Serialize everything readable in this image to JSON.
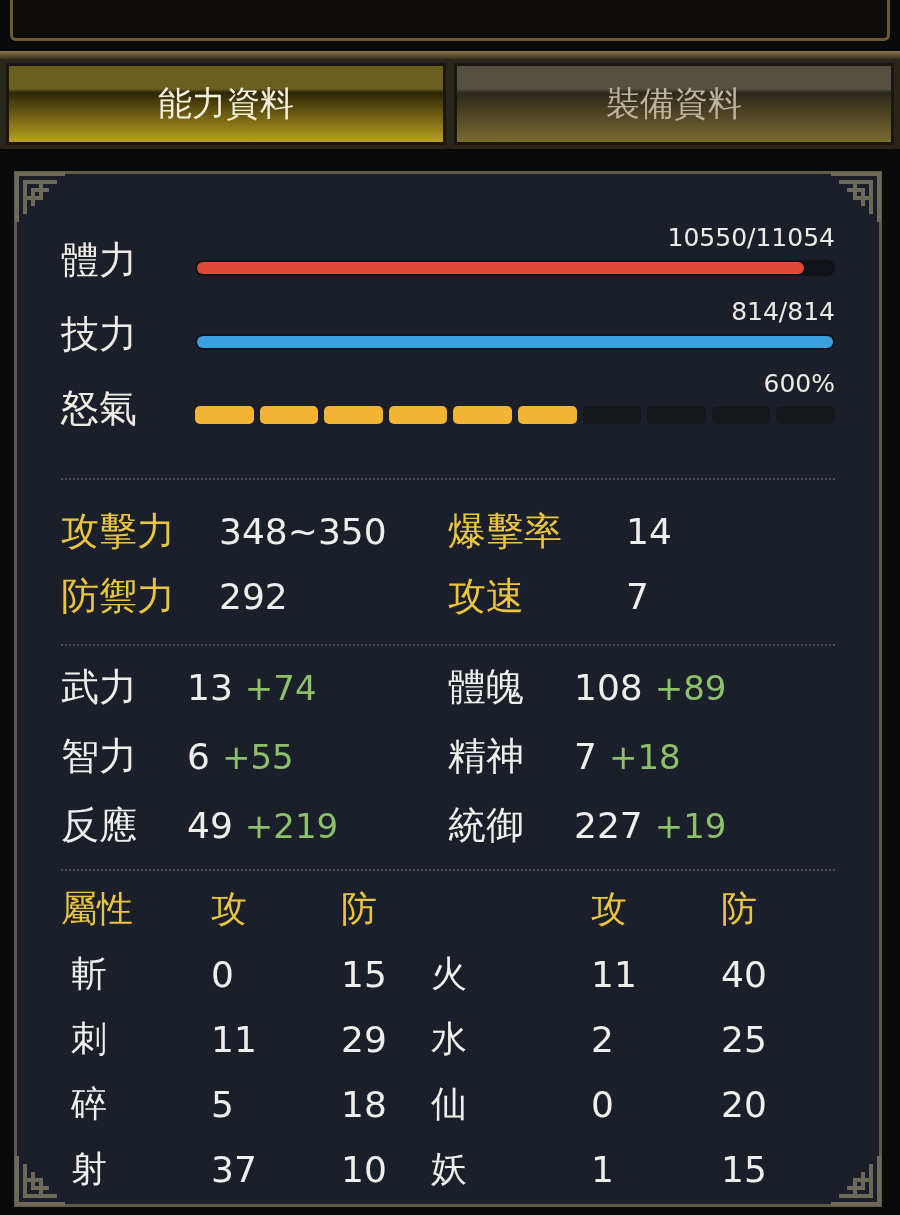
{
  "tabs": [
    {
      "label": "能力資料",
      "selected": true
    },
    {
      "label": "裝備資料",
      "selected": false
    }
  ],
  "gauges": [
    {
      "kind": "bar",
      "label": "體力",
      "reading": "10550/11054",
      "level": 0.954,
      "color": "#e0483a"
    },
    {
      "kind": "bar",
      "label": "技力",
      "reading": "814/814",
      "level": 1,
      "color": "#3aa0e0"
    },
    {
      "kind": "segments",
      "label": "怒氣",
      "reading": "600%",
      "level": 0.6,
      "color": "#f2b533"
    }
  ],
  "combat": [
    {
      "label": "攻擊力",
      "value": "348~350"
    },
    {
      "label": "爆擊率",
      "value": "14"
    },
    {
      "label": "防禦力",
      "value": "292"
    },
    {
      "label": "攻速",
      "value": "7"
    }
  ],
  "stats": [
    {
      "label": "武力",
      "value": "13",
      "bonus": "+74"
    },
    {
      "label": "體魄",
      "value": "108",
      "bonus": "+89"
    },
    {
      "label": "智力",
      "value": "6",
      "bonus": "+55"
    },
    {
      "label": "精神",
      "value": "7",
      "bonus": "+18"
    },
    {
      "label": "反應",
      "value": "49",
      "bonus": "+219"
    },
    {
      "label": "統御",
      "value": "227",
      "bonus": "+19"
    }
  ],
  "attributes": {
    "header": [
      "屬性",
      "攻",
      "防",
      "攻",
      "防"
    ],
    "rows": [
      [
        "斬",
        "0",
        "15",
        "火",
        "11",
        "40"
      ],
      [
        "刺",
        "11",
        "29",
        "水",
        "2",
        "25"
      ],
      [
        "碎",
        "5",
        "18",
        "仙",
        "0",
        "20"
      ],
      [
        "射",
        "37",
        "10",
        "妖",
        "1",
        "15"
      ]
    ]
  }
}
